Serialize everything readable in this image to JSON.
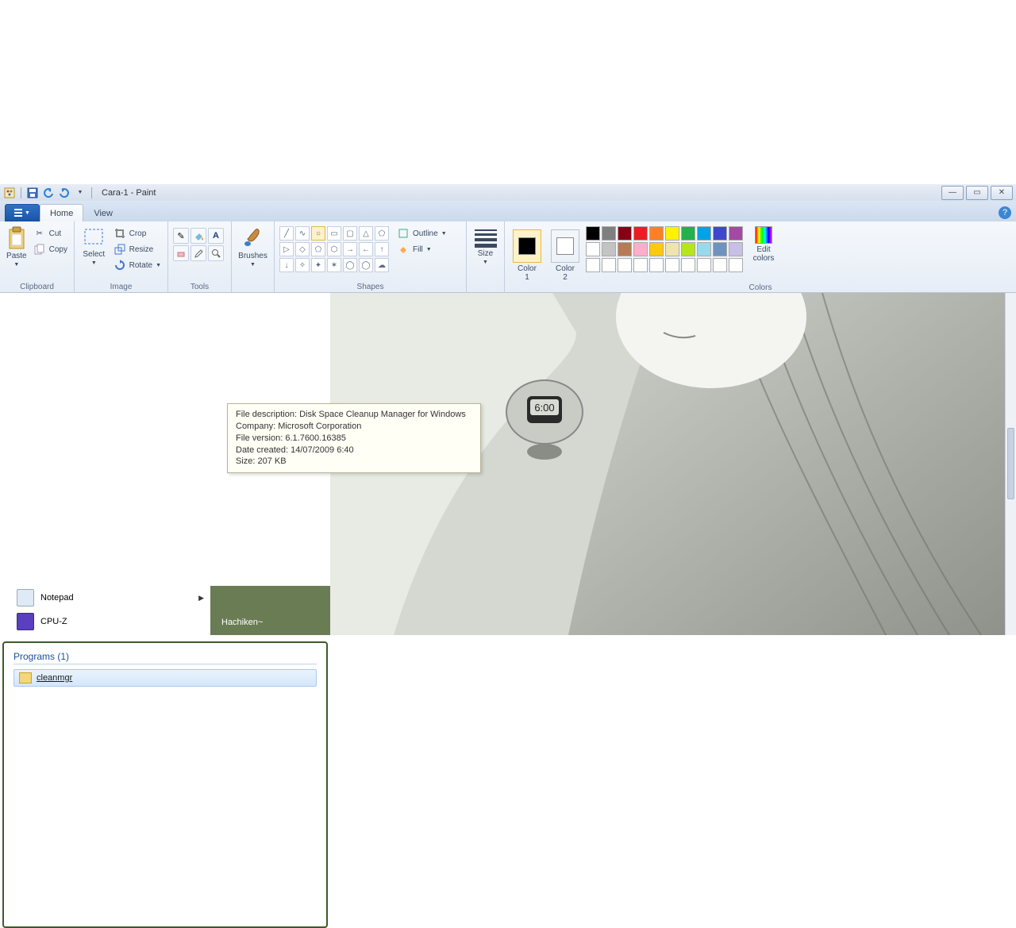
{
  "titlebar": {
    "title": "Cara-1 - Paint"
  },
  "tabs": {
    "file": "",
    "home": "Home",
    "view": "View"
  },
  "ribbon": {
    "clipboard": {
      "paste": "Paste",
      "cut": "Cut",
      "copy": "Copy",
      "label": "Clipboard"
    },
    "image": {
      "select": "Select",
      "crop": "Crop",
      "resize": "Resize",
      "rotate": "Rotate",
      "label": "Image"
    },
    "tools": {
      "label": "Tools"
    },
    "brushes": {
      "label": "Brushes",
      "btn": "Brushes"
    },
    "shapes": {
      "outline": "Outline",
      "fill": "Fill",
      "label": "Shapes"
    },
    "size": {
      "label": "Size",
      "btn": "Size"
    },
    "colors": {
      "c1": "Color\n1",
      "c2": "Color\n2",
      "edit": "Edit\ncolors",
      "label": "Colors",
      "c1_hex": "#000000",
      "c2_hex": "#ffffff",
      "row1": [
        "#000000",
        "#7f7f7f",
        "#880015",
        "#ed1c24",
        "#ff7f27",
        "#fff200",
        "#22b14c",
        "#00a2e8",
        "#3f48cc",
        "#a349a4"
      ],
      "row2": [
        "#ffffff",
        "#c3c3c3",
        "#b97a57",
        "#ffaec9",
        "#ffc90e",
        "#efe4b0",
        "#b5e61d",
        "#99d9ea",
        "#7092be",
        "#c8bfe7"
      ]
    }
  },
  "start": {
    "items": [
      {
        "label": "Notepad",
        "has_sub": true
      },
      {
        "label": "CPU-Z",
        "has_sub": false
      }
    ],
    "user": "Hachiken~",
    "search_header": "Programs (1)",
    "result": "cleanmgr",
    "tooltip": {
      "l1": "File description: Disk Space Cleanup Manager for Windows",
      "l2": "Company: Microsoft Corporation",
      "l3": "File version: 6.1.7600.16385",
      "l4": "Date created: 14/07/2009 6:40",
      "l5": "Size: 207 KB"
    }
  }
}
